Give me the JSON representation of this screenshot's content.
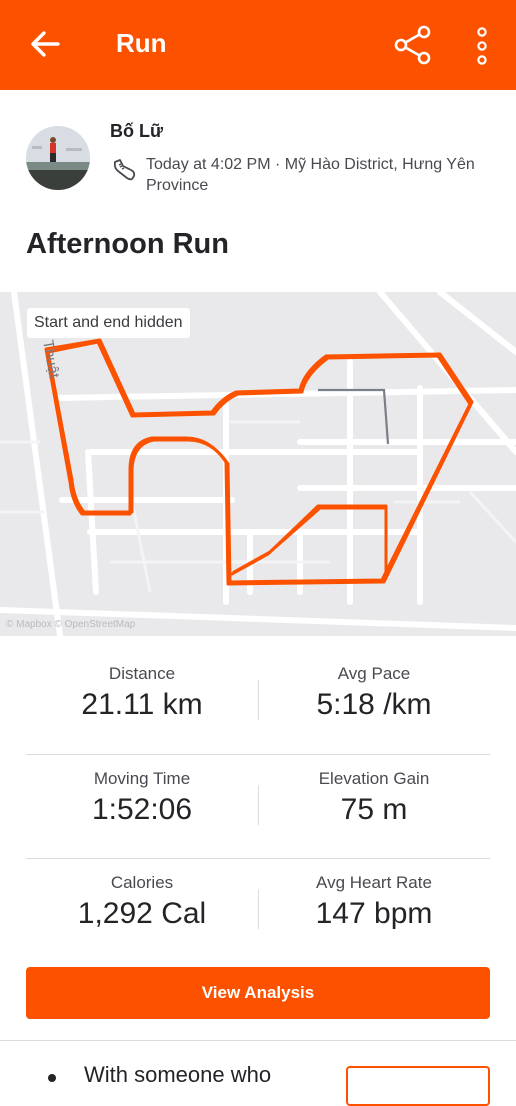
{
  "appbar": {
    "title": "Run",
    "background": "#fc5200",
    "icons": [
      "back-arrow-icon",
      "share-icon",
      "more-vertical-icon"
    ]
  },
  "athlete": {
    "name": "Bố Lữ",
    "meta": "Today at 4:02 PM · Mỹ Hào District, Hưng Yên Province",
    "activity_icon": "shoe-icon"
  },
  "activity": {
    "title": "Afternoon Run"
  },
  "map": {
    "badge": "Start and end hidden",
    "street_label": "iện Thuật",
    "attribution": "© Mapbox © OpenStreetMap",
    "route_color": "#fc5200"
  },
  "stats": [
    [
      {
        "label": "Distance",
        "value": "21.11 km"
      },
      {
        "label": "Avg Pace",
        "value": "5:18 /km"
      }
    ],
    [
      {
        "label": "Moving Time",
        "value": "1:52:06"
      },
      {
        "label": "Elevation Gain",
        "value": "75 m"
      }
    ],
    [
      {
        "label": "Calories",
        "value": "1,292 Cal"
      },
      {
        "label": "Avg Heart Rate",
        "value": "147 bpm"
      }
    ]
  ],
  "analysis_button": "View Analysis",
  "social": {
    "text": "With someone who"
  }
}
